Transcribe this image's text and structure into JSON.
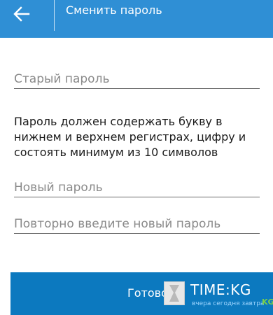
{
  "header": {
    "title": "Сменить пароль",
    "back_icon": "arrow-left-icon",
    "background_color": "#2f8fd5"
  },
  "form": {
    "old_password_placeholder": "Старый пароль",
    "hint": "Пароль должен содержать букву в нижнем и верхнем регистрах, цифру и состоять минимум из 10 символов",
    "new_password_placeholder": "Новый пароль",
    "repeat_password_placeholder": "Повторно введите новый пароль"
  },
  "footer": {
    "done_label": "Готово",
    "background_color": "#0c79bf"
  },
  "watermark": {
    "name": "TIME:KG",
    "tagline": "вчера сегодня завтра",
    "mark": "KG"
  }
}
